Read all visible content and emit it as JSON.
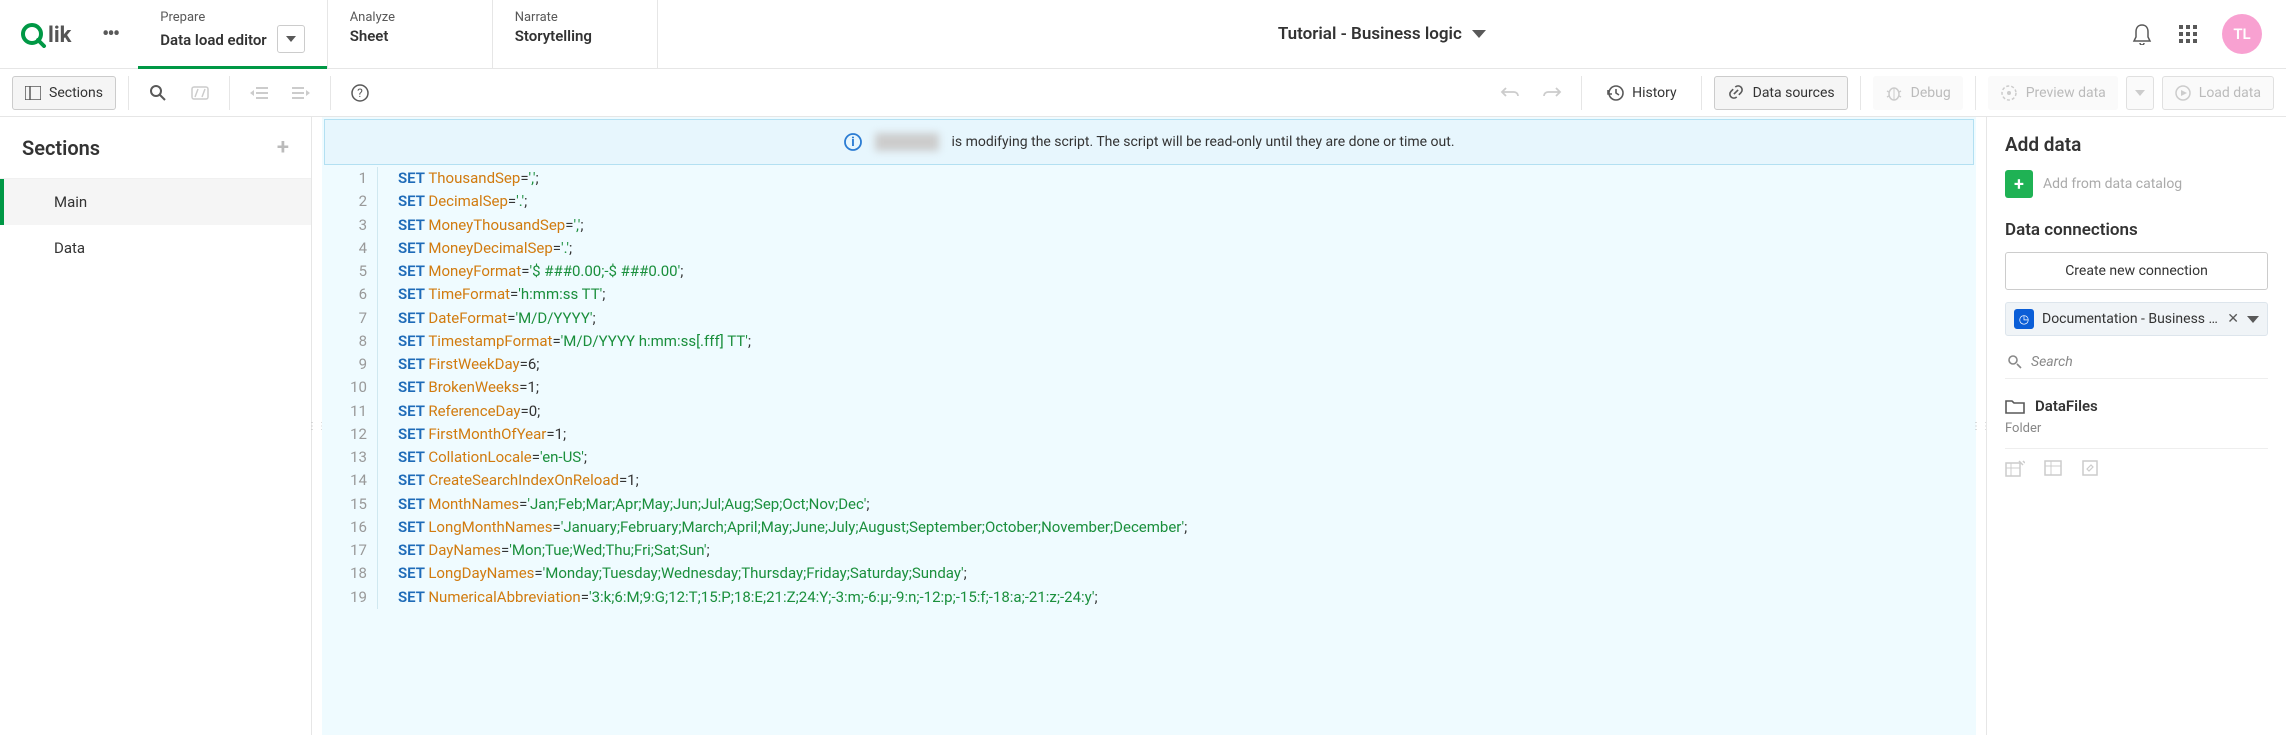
{
  "app_title": "Tutorial - Business logic",
  "avatar_initials": "TL",
  "tabs": {
    "prepare": {
      "small": "Prepare",
      "big": "Data load editor"
    },
    "analyze": {
      "small": "Analyze",
      "big": "Sheet"
    },
    "narrate": {
      "small": "Narrate",
      "big": "Storytelling"
    }
  },
  "toolbar": {
    "sections": "Sections",
    "history": "History",
    "data_sources": "Data sources",
    "debug": "Debug",
    "preview": "Preview data",
    "load": "Load data"
  },
  "sections_panel": {
    "title": "Sections",
    "items": [
      "Main",
      "Data"
    ]
  },
  "notice_text": "is modifying the script. The script will be read-only until they are done or time out.",
  "code_lines": [
    {
      "n": "1",
      "seg": [
        {
          "c": "set",
          "t": "SET "
        },
        {
          "c": "var",
          "t": "ThousandSep"
        },
        {
          "c": "plain",
          "t": "="
        },
        {
          "c": "str",
          "t": "','"
        },
        {
          "c": "plain",
          "t": ";"
        }
      ]
    },
    {
      "n": "2",
      "seg": [
        {
          "c": "set",
          "t": "SET "
        },
        {
          "c": "var",
          "t": "DecimalSep"
        },
        {
          "c": "plain",
          "t": "="
        },
        {
          "c": "str",
          "t": "'.'"
        },
        {
          "c": "plain",
          "t": ";"
        }
      ]
    },
    {
      "n": "3",
      "seg": [
        {
          "c": "set",
          "t": "SET "
        },
        {
          "c": "var",
          "t": "MoneyThousandSep"
        },
        {
          "c": "plain",
          "t": "="
        },
        {
          "c": "str",
          "t": "','"
        },
        {
          "c": "plain",
          "t": ";"
        }
      ]
    },
    {
      "n": "4",
      "seg": [
        {
          "c": "set",
          "t": "SET "
        },
        {
          "c": "var",
          "t": "MoneyDecimalSep"
        },
        {
          "c": "plain",
          "t": "="
        },
        {
          "c": "str",
          "t": "'.'"
        },
        {
          "c": "plain",
          "t": ";"
        }
      ]
    },
    {
      "n": "5",
      "seg": [
        {
          "c": "set",
          "t": "SET "
        },
        {
          "c": "var",
          "t": "MoneyFormat"
        },
        {
          "c": "plain",
          "t": "="
        },
        {
          "c": "str",
          "t": "'$ ###0.00;-$ ###0.00'"
        },
        {
          "c": "plain",
          "t": ";"
        }
      ]
    },
    {
      "n": "6",
      "seg": [
        {
          "c": "set",
          "t": "SET "
        },
        {
          "c": "var",
          "t": "TimeFormat"
        },
        {
          "c": "plain",
          "t": "="
        },
        {
          "c": "str",
          "t": "'h:mm:ss TT'"
        },
        {
          "c": "plain",
          "t": ";"
        }
      ]
    },
    {
      "n": "7",
      "seg": [
        {
          "c": "set",
          "t": "SET "
        },
        {
          "c": "var",
          "t": "DateFormat"
        },
        {
          "c": "plain",
          "t": "="
        },
        {
          "c": "str",
          "t": "'M/D/YYYY'"
        },
        {
          "c": "plain",
          "t": ";"
        }
      ]
    },
    {
      "n": "8",
      "seg": [
        {
          "c": "set",
          "t": "SET "
        },
        {
          "c": "var",
          "t": "TimestampFormat"
        },
        {
          "c": "plain",
          "t": "="
        },
        {
          "c": "str",
          "t": "'M/D/YYYY h:mm:ss[.fff] TT'"
        },
        {
          "c": "plain",
          "t": ";"
        }
      ]
    },
    {
      "n": "9",
      "seg": [
        {
          "c": "set",
          "t": "SET "
        },
        {
          "c": "var",
          "t": "FirstWeekDay"
        },
        {
          "c": "plain",
          "t": "=6;"
        }
      ]
    },
    {
      "n": "10",
      "seg": [
        {
          "c": "set",
          "t": "SET "
        },
        {
          "c": "var",
          "t": "BrokenWeeks"
        },
        {
          "c": "plain",
          "t": "=1;"
        }
      ]
    },
    {
      "n": "11",
      "seg": [
        {
          "c": "set",
          "t": "SET "
        },
        {
          "c": "var",
          "t": "ReferenceDay"
        },
        {
          "c": "plain",
          "t": "=0;"
        }
      ]
    },
    {
      "n": "12",
      "seg": [
        {
          "c": "set",
          "t": "SET "
        },
        {
          "c": "var",
          "t": "FirstMonthOfYear"
        },
        {
          "c": "plain",
          "t": "=1;"
        }
      ]
    },
    {
      "n": "13",
      "seg": [
        {
          "c": "set",
          "t": "SET "
        },
        {
          "c": "var",
          "t": "CollationLocale"
        },
        {
          "c": "plain",
          "t": "="
        },
        {
          "c": "str",
          "t": "'en-US'"
        },
        {
          "c": "plain",
          "t": ";"
        }
      ]
    },
    {
      "n": "14",
      "seg": [
        {
          "c": "set",
          "t": "SET "
        },
        {
          "c": "var",
          "t": "CreateSearchIndexOnReload"
        },
        {
          "c": "plain",
          "t": "=1;"
        }
      ]
    },
    {
      "n": "15",
      "seg": [
        {
          "c": "set",
          "t": "SET "
        },
        {
          "c": "var",
          "t": "MonthNames"
        },
        {
          "c": "plain",
          "t": "="
        },
        {
          "c": "str",
          "t": "'Jan;Feb;Mar;Apr;May;Jun;Jul;Aug;Sep;Oct;Nov;Dec'"
        },
        {
          "c": "plain",
          "t": ";"
        }
      ]
    },
    {
      "n": "16",
      "seg": [
        {
          "c": "set",
          "t": "SET "
        },
        {
          "c": "var",
          "t": "LongMonthNames"
        },
        {
          "c": "plain",
          "t": "="
        },
        {
          "c": "str",
          "t": "'January;February;March;April;May;June;July;August;September;October;November;December'"
        },
        {
          "c": "plain",
          "t": ";"
        }
      ]
    },
    {
      "n": "17",
      "seg": [
        {
          "c": "set",
          "t": "SET "
        },
        {
          "c": "var",
          "t": "DayNames"
        },
        {
          "c": "plain",
          "t": "="
        },
        {
          "c": "str",
          "t": "'Mon;Tue;Wed;Thu;Fri;Sat;Sun'"
        },
        {
          "c": "plain",
          "t": ";"
        }
      ]
    },
    {
      "n": "18",
      "seg": [
        {
          "c": "set",
          "t": "SET "
        },
        {
          "c": "var",
          "t": "LongDayNames"
        },
        {
          "c": "plain",
          "t": "="
        },
        {
          "c": "str",
          "t": "'Monday;Tuesday;Wednesday;Thursday;Friday;Saturday;Sunday'"
        },
        {
          "c": "plain",
          "t": ";"
        }
      ]
    },
    {
      "n": "19",
      "seg": [
        {
          "c": "set",
          "t": "SET "
        },
        {
          "c": "var",
          "t": "NumericalAbbreviation"
        },
        {
          "c": "plain",
          "t": "="
        },
        {
          "c": "str",
          "t": "'3:k;6:M;9:G;12:T;15:P;18:E;21:Z;24:Y;-3:m;-6:μ;-9:n;-12:p;-15:f;-18:a;-21:z;-24:y'"
        },
        {
          "c": "plain",
          "t": ";"
        }
      ]
    }
  ],
  "right": {
    "add_data": "Add data",
    "add_from_catalog": "Add from data catalog",
    "data_connections": "Data connections",
    "create_conn": "Create new connection",
    "connection_name": "Documentation - Business Logic ...",
    "search_placeholder": "Search",
    "datafiles": "DataFiles",
    "folder": "Folder"
  }
}
